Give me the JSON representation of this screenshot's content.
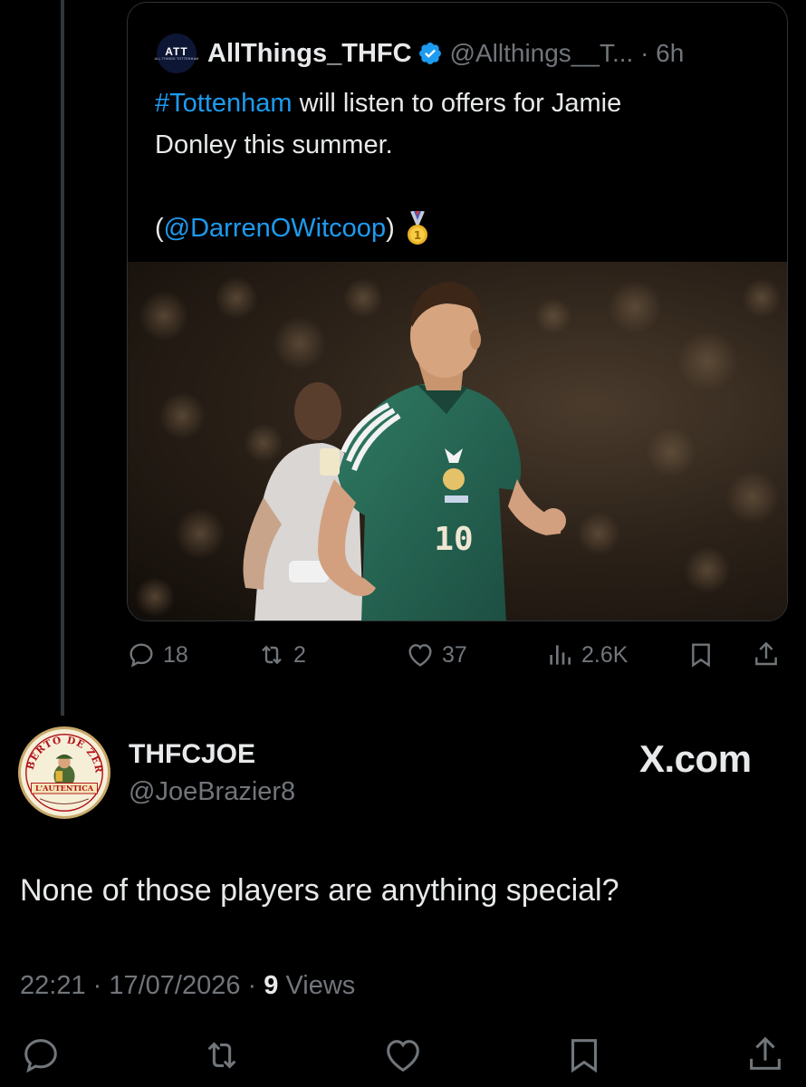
{
  "quoted_tweet": {
    "avatar_text": "ATT",
    "avatar_subtext": "ALL THINGS TOTTENHAM",
    "name": "AllThings_THFC",
    "handle_time": "@Allthings__T... · 6h",
    "text_hashtag": "#Tottenham",
    "text_line1_rest": " will listen to offers for Jamie",
    "text_line2": "Donley this summer.",
    "text_paren_open": "(",
    "text_mention": "@DarrenOWitcoop",
    "text_paren_close": ")",
    "medal_icon": "first-place-medal-icon",
    "photo_shirt_number": "10",
    "stats": {
      "replies": "18",
      "reposts": "2",
      "likes": "37",
      "views": "2.6K"
    }
  },
  "reply": {
    "avatar_text_top": "ROBERTO DE ZERBI",
    "avatar_text_banner": "L'AUTENTICA",
    "name": "THFCJOE",
    "handle": "@JoeBrazier8",
    "watermark": "X.com",
    "text": "None of those players are anything special?",
    "time_date": "22:21 · 17/07/2026 · ",
    "views_count": "9",
    "views_label": " Views"
  },
  "colors": {
    "background": "#000000",
    "text": "#e7e9ea",
    "muted": "#71767b",
    "link": "#1d9bf0",
    "verified": "#1d9bf0"
  }
}
